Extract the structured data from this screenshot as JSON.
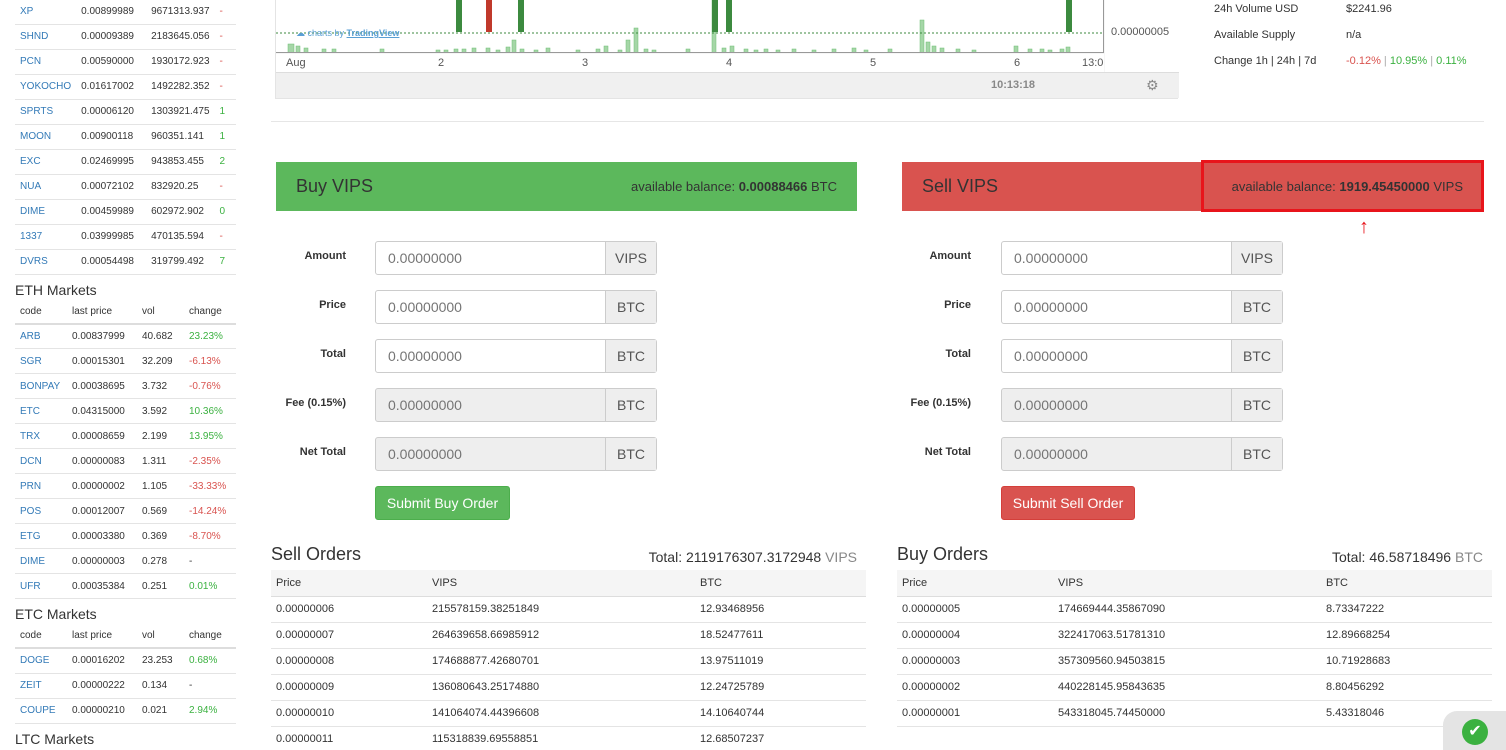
{
  "markets_top": {
    "rows": [
      {
        "code": "XP",
        "last": "0.00899989",
        "vol": "9671313.937",
        "chg": "-",
        "cls": "neg"
      },
      {
        "code": "SHND",
        "last": "0.00009389",
        "vol": "2183645.056",
        "chg": "-",
        "cls": "neg"
      },
      {
        "code": "PCN",
        "last": "0.00590000",
        "vol": "1930172.923",
        "chg": "-",
        "cls": "neg"
      },
      {
        "code": "YOKOCHO",
        "last": "0.01617002",
        "vol": "1492282.352",
        "chg": "-",
        "cls": "neg"
      },
      {
        "code": "SPRTS",
        "last": "0.00006120",
        "vol": "1303921.475",
        "chg": "1",
        "cls": "pos"
      },
      {
        "code": "MOON",
        "last": "0.00900118",
        "vol": "960351.141",
        "chg": "1",
        "cls": "pos"
      },
      {
        "code": "EXC",
        "last": "0.02469995",
        "vol": "943853.455",
        "chg": "2",
        "cls": "pos"
      },
      {
        "code": "NUA",
        "last": "0.00072102",
        "vol": "832920.25",
        "chg": "-",
        "cls": "neg"
      },
      {
        "code": "DIME",
        "last": "0.00459989",
        "vol": "602972.902",
        "chg": "0",
        "cls": "pos"
      },
      {
        "code": "1337",
        "last": "0.03999985",
        "vol": "470135.594",
        "chg": "-",
        "cls": "neg"
      },
      {
        "code": "DVRS",
        "last": "0.00054498",
        "vol": "319799.492",
        "chg": "7",
        "cls": "pos"
      }
    ]
  },
  "eth_markets": {
    "title": "ETH Markets",
    "headers": {
      "code": "code",
      "last": "last price",
      "vol": "vol",
      "chg": "change"
    },
    "rows": [
      {
        "code": "ARB",
        "last": "0.00837999",
        "vol": "40.682",
        "chg": "23.23%",
        "cls": "pos"
      },
      {
        "code": "SGR",
        "last": "0.00015301",
        "vol": "32.209",
        "chg": "-6.13%",
        "cls": "neg"
      },
      {
        "code": "BONPAY",
        "last": "0.00038695",
        "vol": "3.732",
        "chg": "-0.76%",
        "cls": "neg"
      },
      {
        "code": "ETC",
        "last": "0.04315000",
        "vol": "3.592",
        "chg": "10.36%",
        "cls": "pos"
      },
      {
        "code": "TRX",
        "last": "0.00008659",
        "vol": "2.199",
        "chg": "13.95%",
        "cls": "pos"
      },
      {
        "code": "DCN",
        "last": "0.00000083",
        "vol": "1.311",
        "chg": "-2.35%",
        "cls": "neg"
      },
      {
        "code": "PRN",
        "last": "0.00000002",
        "vol": "1.105",
        "chg": "-33.33%",
        "cls": "neg"
      },
      {
        "code": "POS",
        "last": "0.00012007",
        "vol": "0.569",
        "chg": "-14.24%",
        "cls": "neg"
      },
      {
        "code": "ETG",
        "last": "0.00003380",
        "vol": "0.369",
        "chg": "-8.70%",
        "cls": "neg"
      },
      {
        "code": "DIME",
        "last": "0.00000003",
        "vol": "0.278",
        "chg": "-",
        "cls": ""
      },
      {
        "code": "UFR",
        "last": "0.00035384",
        "vol": "0.251",
        "chg": "0.01%",
        "cls": "pos"
      }
    ]
  },
  "etc_markets": {
    "title": "ETC Markets",
    "headers": {
      "code": "code",
      "last": "last price",
      "vol": "vol",
      "chg": "change"
    },
    "rows": [
      {
        "code": "DOGE",
        "last": "0.00016202",
        "vol": "23.253",
        "chg": "0.68%",
        "cls": "pos"
      },
      {
        "code": "ZEIT",
        "last": "0.00000222",
        "vol": "0.134",
        "chg": "-",
        "cls": ""
      },
      {
        "code": "COUPE",
        "last": "0.00000210",
        "vol": "0.021",
        "chg": "2.94%",
        "cls": "pos"
      }
    ]
  },
  "ltc_markets": {
    "title": "LTC Markets"
  },
  "chart": {
    "x_labels": [
      "Aug",
      "2",
      "3",
      "4",
      "5",
      "6",
      "13:0"
    ],
    "y_label": "0.00000005",
    "time": "10:13:18",
    "logo": "charts by",
    "logo_brand": "TradingView"
  },
  "stats": {
    "volume_label": "24h Volume USD",
    "volume_value": "$2241.96",
    "supply_label": "Available Supply",
    "supply_value": "n/a",
    "change_label": "Change 1h | 24h | 7d",
    "change_1h": "-0.12%",
    "change_24h": "10.95%",
    "change_7d": "0.11%",
    "sep": "|",
    "colors": {
      "pos": "#3bb140",
      "neg": "#d9534f"
    }
  },
  "buy_panel": {
    "title": "Buy VIPS",
    "balance_label": "available balance:",
    "balance_value": "0.00088466",
    "balance_unit": "BTC",
    "fields": [
      {
        "label": "Amount",
        "placeholder": "0.00000000",
        "unit": "VIPS"
      },
      {
        "label": "Price",
        "placeholder": "0.00000000",
        "unit": "BTC"
      },
      {
        "label": "Total",
        "placeholder": "0.00000000",
        "unit": "BTC"
      },
      {
        "label": "Fee (0.15%)",
        "placeholder": "0.00000000",
        "unit": "BTC"
      },
      {
        "label": "Net Total",
        "placeholder": "0.00000000",
        "unit": "BTC"
      }
    ],
    "submit": "Submit Buy Order",
    "color": "#5cb85c"
  },
  "sell_panel": {
    "title": "Sell VIPS",
    "balance_label": "available balance:",
    "balance_value": "1919.45450000",
    "balance_unit": "VIPS",
    "fields": [
      {
        "label": "Amount",
        "placeholder": "0.00000000",
        "unit": "VIPS"
      },
      {
        "label": "Price",
        "placeholder": "0.00000000",
        "unit": "BTC"
      },
      {
        "label": "Total",
        "placeholder": "0.00000000",
        "unit": "BTC"
      },
      {
        "label": "Fee (0.15%)",
        "placeholder": "0.00000000",
        "unit": "BTC"
      },
      {
        "label": "Net Total",
        "placeholder": "0.00000000",
        "unit": "BTC"
      }
    ],
    "submit": "Submit Sell Order",
    "color": "#d9534f",
    "annotation": "↑"
  },
  "sell_orders": {
    "title": "Sell Orders",
    "total_label": "Total:",
    "total_value": "2119176307.3172948",
    "total_unit": "VIPS",
    "headers": [
      "Price",
      "VIPS",
      "BTC"
    ],
    "rows": [
      [
        "0.00000006",
        "215578159.38251849",
        "12.93468956"
      ],
      [
        "0.00000007",
        "264639658.66985912",
        "18.52477611"
      ],
      [
        "0.00000008",
        "174688877.42680701",
        "13.97511019"
      ],
      [
        "0.00000009",
        "136080643.25174880",
        "12.24725789"
      ],
      [
        "0.00000010",
        "141064074.44396608",
        "14.10640744"
      ],
      [
        "0.00000011",
        "115318839.69558851",
        "12.68507237"
      ]
    ]
  },
  "buy_orders": {
    "title": "Buy Orders",
    "total_label": "Total:",
    "total_value": "46.58718496",
    "total_unit": "BTC",
    "headers": [
      "Price",
      "VIPS",
      "BTC"
    ],
    "rows": [
      [
        "0.00000005",
        "174669444.35867090",
        "8.73347222"
      ],
      [
        "0.00000004",
        "322417063.51781310",
        "12.89668254"
      ],
      [
        "0.00000003",
        "357309560.94503815",
        "10.71928683"
      ],
      [
        "0.00000002",
        "440228145.95843635",
        "8.80456292"
      ],
      [
        "0.00000001",
        "543318045.74450000",
        "5.43318046"
      ]
    ]
  },
  "status_badge": {
    "icon": "check-icon",
    "glyph": "✔"
  }
}
